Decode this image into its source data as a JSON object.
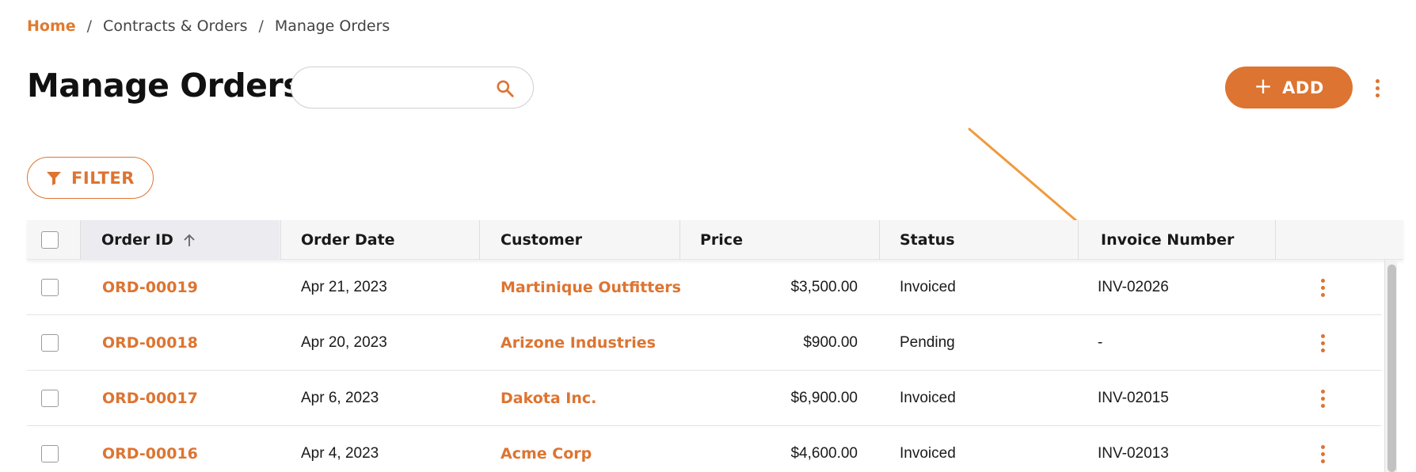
{
  "breadcrumb": {
    "home": "Home",
    "separator": "/",
    "level2": "Contracts & Orders",
    "level3": "Manage Orders"
  },
  "page": {
    "title": "Manage Orders"
  },
  "search": {
    "value": "",
    "placeholder": ""
  },
  "toolbar": {
    "add_label": "ADD",
    "filter_label": "FILTER"
  },
  "table": {
    "columns": {
      "order_id": "Order ID",
      "order_date": "Order Date",
      "customer": "Customer",
      "price": "Price",
      "status": "Status",
      "invoice_number": "Invoice Number"
    },
    "sort": {
      "column": "Order ID",
      "direction": "ascending"
    },
    "rows": [
      {
        "order_id": "ORD-00019",
        "order_date": "Apr 21, 2023",
        "customer": "Martinique Outfitters",
        "price": "$3,500.00",
        "status": "Invoiced",
        "invoice_number": "INV-02026"
      },
      {
        "order_id": "ORD-00018",
        "order_date": "Apr 20, 2023",
        "customer": "Arizone Industries",
        "price": "$900.00",
        "status": "Pending",
        "invoice_number": "-"
      },
      {
        "order_id": "ORD-00017",
        "order_date": "Apr 6, 2023",
        "customer": "Dakota Inc.",
        "price": "$6,900.00",
        "status": "Invoiced",
        "invoice_number": "INV-02015"
      },
      {
        "order_id": "ORD-00016",
        "order_date": "Apr 4, 2023",
        "customer": "Acme Corp",
        "price": "$4,600.00",
        "status": "Invoiced",
        "invoice_number": "INV-02013"
      }
    ]
  },
  "colors": {
    "accent": "#dd7431",
    "annotation_arrow": "#f09a3e",
    "header_bg": "#f6f6f6"
  },
  "icons": {
    "search": "search-icon",
    "add": "plus-icon",
    "filter": "funnel-icon",
    "sort": "arrow-up-icon",
    "menu": "kebab-menu-icon"
  }
}
